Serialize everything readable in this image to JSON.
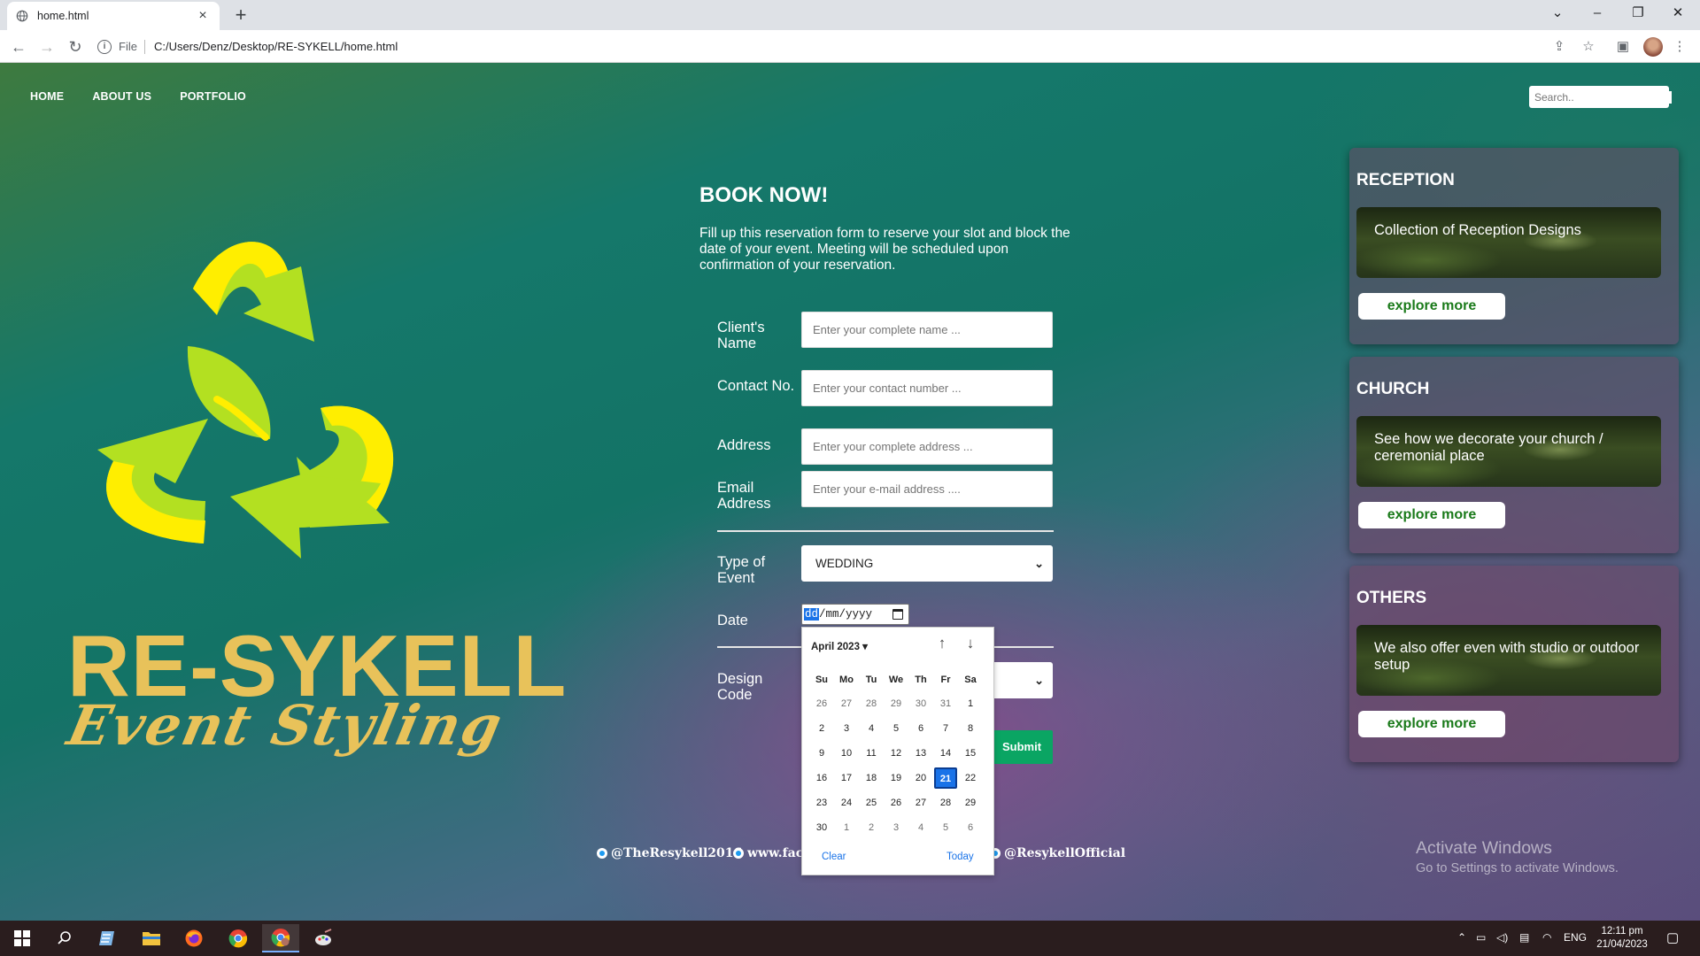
{
  "browser": {
    "tab_title": "home.html",
    "new_tab": "+",
    "file_label": "File",
    "url": "C:/Users/Denz/Desktop/RE-SYKELL/home.html"
  },
  "nav": {
    "items": [
      "HOME",
      "ABOUT US",
      "PORTFOLIO"
    ]
  },
  "search": {
    "placeholder": "Search.."
  },
  "brand": {
    "name": "RE-SYKELL",
    "tagline": "Event Styling"
  },
  "form": {
    "title": "BOOK NOW!",
    "description": "Fill up this reservation form to reserve your slot and block the date of your event. Meeting will be scheduled upon confirmation of your reservation.",
    "fields": {
      "client_name": {
        "label": "Client's Name",
        "placeholder": "Enter your complete name ..."
      },
      "contact": {
        "label": "Contact No.",
        "placeholder": "Enter your contact number ..."
      },
      "address": {
        "label": "Address",
        "placeholder": "Enter your complete address ..."
      },
      "email": {
        "label": "Email Address",
        "placeholder": "Enter your e-mail address ...."
      },
      "event_type": {
        "label": "Type of Event",
        "value": "WEDDING"
      },
      "date": {
        "label": "Date",
        "dd": "dd",
        "rest": "/mm/yyyy"
      },
      "design_code": {
        "label": "Design Code"
      }
    },
    "submit_label": "Submit"
  },
  "datepicker": {
    "month_label": "April 2023 ▾",
    "weekdays": [
      "Su",
      "Mo",
      "Tu",
      "We",
      "Th",
      "Fr",
      "Sa"
    ],
    "weeks": [
      [
        "26",
        "27",
        "28",
        "29",
        "30",
        "31",
        "1"
      ],
      [
        "2",
        "3",
        "4",
        "5",
        "6",
        "7",
        "8"
      ],
      [
        "9",
        "10",
        "11",
        "12",
        "13",
        "14",
        "15"
      ],
      [
        "16",
        "17",
        "18",
        "19",
        "20",
        "21",
        "22"
      ],
      [
        "23",
        "24",
        "25",
        "26",
        "27",
        "28",
        "29"
      ],
      [
        "30",
        "1",
        "2",
        "3",
        "4",
        "5",
        "6"
      ]
    ],
    "selected": "21",
    "clear_label": "Clear",
    "today_label": "Today"
  },
  "social": {
    "twitter": "@TheResykell2016",
    "facebook": "www.face",
    "instagram": "@ResykellOfficial"
  },
  "cards": [
    {
      "title": "RECEPTION",
      "text": "Collection of Reception Designs",
      "button": "explore more"
    },
    {
      "title": "CHURCH",
      "text": "See how we decorate your church / ceremonial place",
      "button": "explore more"
    },
    {
      "title": "OTHERS",
      "text": "We also offer even with studio or outdoor setup",
      "button": "explore more"
    }
  ],
  "watermark": {
    "line1": "Activate Windows",
    "line2": "Go to Settings to activate Windows."
  },
  "taskbar": {
    "lang": "ENG",
    "time": "12:11 pm",
    "date": "21/04/2023"
  },
  "colors": {
    "brand_gold": "#e8c25a",
    "submit_green": "#0aa563",
    "accent_blue": "#1a73e8",
    "leaf_green": "#b3e021",
    "leaf_yellow": "#ffee00"
  }
}
